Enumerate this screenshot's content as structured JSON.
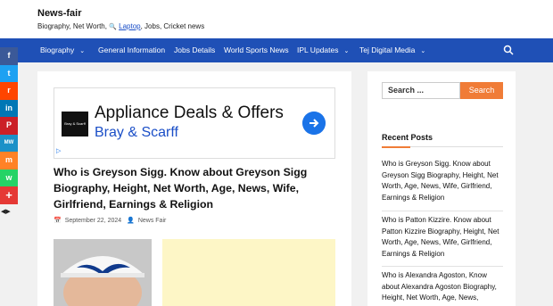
{
  "header": {
    "site_title": "News-fair",
    "tagline_before": "Biography, Net Worth, ",
    "tagline_laptop": "Laptop",
    "tagline_after": ", Jobs, Cricket news"
  },
  "nav": {
    "items": [
      {
        "label": "Biography",
        "has_dropdown": true
      },
      {
        "label": "General Information",
        "has_dropdown": false
      },
      {
        "label": "Jobs Details",
        "has_dropdown": false
      },
      {
        "label": "World Sports News",
        "has_dropdown": false
      },
      {
        "label": "IPL Updates",
        "has_dropdown": true
      },
      {
        "label": "Tej Digital Media",
        "has_dropdown": true
      }
    ],
    "background": "#1f50b6"
  },
  "social": [
    {
      "icon": "facebook-icon",
      "glyph": "f",
      "color": "#3b5998"
    },
    {
      "icon": "twitter-icon",
      "glyph": "t",
      "color": "#1da1f2"
    },
    {
      "icon": "reddit-icon",
      "glyph": "r",
      "color": "#ff4500"
    },
    {
      "icon": "linkedin-icon",
      "glyph": "in",
      "color": "#0077b5"
    },
    {
      "icon": "pinterest-icon",
      "glyph": "P",
      "color": "#cb2027"
    },
    {
      "icon": "mewe-icon",
      "glyph": "MW",
      "color": "#1b91c8"
    },
    {
      "icon": "mix-icon",
      "glyph": "m",
      "color": "#ff8226"
    },
    {
      "icon": "whatsapp-icon",
      "glyph": "w",
      "color": "#25d366"
    },
    {
      "icon": "more-icon",
      "glyph": "+",
      "color": "#e53935"
    }
  ],
  "ad": {
    "logo_text": "Bray & Scarff",
    "title": "Appliance Deals & Offers",
    "subtitle": "Bray & Scarff"
  },
  "post": {
    "title": "Who is Greyson Sigg. Know about Greyson Sigg Biography, Height, Net Worth, Age, News, Wife, Girlfriend, Earnings & Religion",
    "date": "September 22, 2024",
    "author": "News Fair"
  },
  "sidebar": {
    "search_placeholder": "Search ...",
    "search_button": "Search",
    "recent_title": "Recent Posts",
    "recent_posts": [
      "Who is Greyson Sigg. Know about Greyson Sigg Biography, Height, Net Worth, Age, News, Wife, Girlfriend, Earnings & Religion",
      "Who is Patton Kizzire. Know about Patton Kizzire Biography, Height, Net Worth, Age, News, Wife, Girlfriend, Earnings & Religion",
      "Who is Alexandra Agoston, Know about Alexandra Agoston Biography, Height, Net Worth, Age, News,"
    ]
  },
  "colors": {
    "accent": "#f07c37",
    "link": "#1a4ec7"
  }
}
